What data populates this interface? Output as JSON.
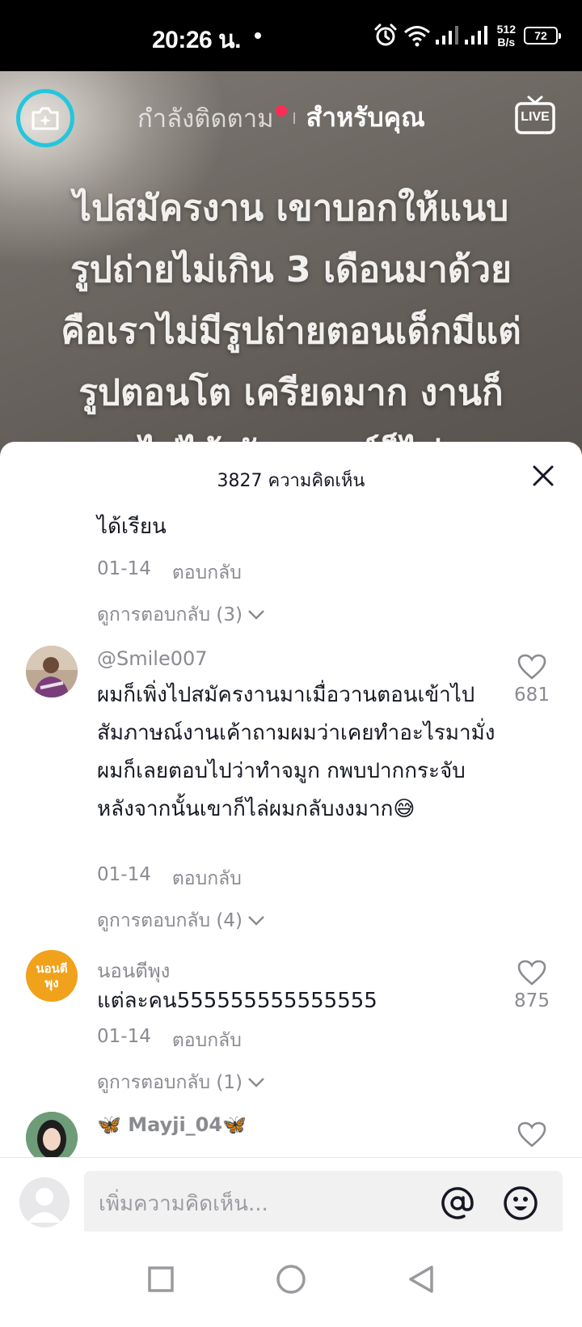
{
  "status_bar": {
    "time": "20:26 น.",
    "net_speed_value": "512",
    "net_speed_unit": "B/s",
    "battery": "72"
  },
  "top_bar": {
    "following_tab": "กำลังติดตาม",
    "for_you_tab": "สำหรับคุณ",
    "live_label": "LIVE"
  },
  "video": {
    "caption_lines": [
      "ไปสมัครงาน เขาบอกให้แนบ",
      "รูปถ่ายไม่เกิน 3 เดือนมาด้วย",
      "คือเราไม่มีรูปถ่ายตอนเด็กมีแต่",
      "รูปตอนโต เครียดมาก งานก็",
      "ไม่ได้ สัมภาษณ์ก็ไม่"
    ]
  },
  "comments_sheet": {
    "title": "3827 ความคิดเห็น",
    "partial_comment": {
      "text_tail": "ได้เรียน",
      "date": "01-14",
      "reply_label": "ตอบกลับ",
      "view_replies": "ดูการตอบกลับ (3)"
    },
    "comments": [
      {
        "username": "@Smile007",
        "text": "ผมก็เพิ่งไปสมัครงานมาเมื่อวานตอนเข้าไปสัมภาษณ์งานเค้าถามผมว่าเคยทำอะไรมามั่ง ผมก็เลยตอบไปว่าทำจมูก กพบปากกระจับหลังจากนั้นเขาก็ไล่ผมกลับงงมาก😅",
        "likes": "681",
        "date": "01-14",
        "reply_label": "ตอบกลับ",
        "view_replies": "ดูการตอบกลับ (4)"
      },
      {
        "username": "นอนตีพุง",
        "avatar_text": "นอนตีพุง",
        "text": "แต่ละคน555555555555555",
        "likes": "875",
        "date": "01-14",
        "reply_label": "ตอบกลับ",
        "view_replies": "ดูการตอบกลับ (1)"
      },
      {
        "username": "🦋 Mayji_04🦋"
      }
    ]
  },
  "input_bar": {
    "placeholder": "เพิ่มความคิดเห็น..."
  },
  "colors": {
    "accent_red": "#fe2c55",
    "camera_ring": "#24c6dc",
    "avatar_yellow": "#f0a21c"
  },
  "icons": [
    "alarm-icon",
    "wifi-icon",
    "signal-icon",
    "battery-icon",
    "camera-sparkle-icon",
    "live-tv-icon",
    "close-icon",
    "chevron-down-icon",
    "heart-icon",
    "at-icon",
    "emoji-icon",
    "nav-recent-icon",
    "nav-home-icon",
    "nav-back-icon"
  ]
}
